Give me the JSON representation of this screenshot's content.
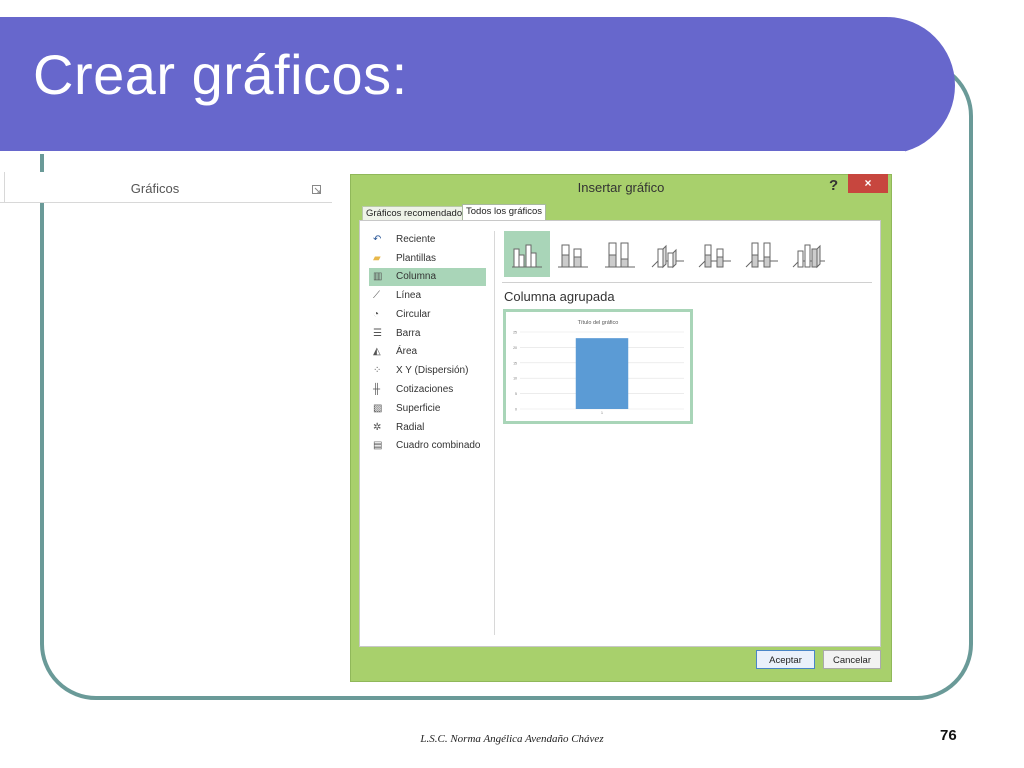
{
  "slide": {
    "title": "Crear gráficos:",
    "footer": "L.S.C. Norma Angélica Avendaño Chávez",
    "page_number": "76"
  },
  "ribbon": {
    "group_label": "Gráficos",
    "launcher_icon": "dialog-launcher-icon"
  },
  "dialog": {
    "title": "Insertar gráfico",
    "help": "?",
    "close": "×",
    "tabs": [
      {
        "label": "Gráficos recomendados",
        "active": false
      },
      {
        "label": "Todos los gráficos",
        "active": true
      }
    ],
    "chart_types": [
      {
        "label": "Reciente",
        "icon": "undo-arrow-icon",
        "glyph": "↶"
      },
      {
        "label": "Plantillas",
        "icon": "folder-icon",
        "glyph": "▰"
      },
      {
        "label": "Columna",
        "icon": "column-chart-icon",
        "glyph": "▥",
        "selected": true
      },
      {
        "label": "Línea",
        "icon": "line-chart-icon",
        "glyph": "⟋"
      },
      {
        "label": "Circular",
        "icon": "pie-chart-icon",
        "glyph": "◔"
      },
      {
        "label": "Barra",
        "icon": "bar-chart-icon",
        "glyph": "☰"
      },
      {
        "label": "Área",
        "icon": "area-chart-icon",
        "glyph": "◭"
      },
      {
        "label": "X Y (Dispersión)",
        "icon": "scatter-chart-icon",
        "glyph": "⁘"
      },
      {
        "label": "Cotizaciones",
        "icon": "stock-chart-icon",
        "glyph": "╫"
      },
      {
        "label": "Superficie",
        "icon": "surface-chart-icon",
        "glyph": "▧"
      },
      {
        "label": "Radial",
        "icon": "radar-chart-icon",
        "glyph": "✲"
      },
      {
        "label": "Cuadro combinado",
        "icon": "combo-chart-icon",
        "glyph": "▤"
      }
    ],
    "selected_subtype": "Columna agrupada",
    "buttons": {
      "ok": "Aceptar",
      "cancel": "Cancelar"
    },
    "colors": {
      "accent": "#a8d06c",
      "selection": "#a9d5b8",
      "bar": "#5b9bd5",
      "close": "#c7463e"
    }
  },
  "chart_data": {
    "type": "bar",
    "title": "Título del gráfico",
    "categories": [
      "1"
    ],
    "values": [
      23
    ],
    "ylim": [
      0,
      25
    ],
    "yticks": [
      0,
      5,
      10,
      15,
      20,
      25
    ],
    "grid": true
  }
}
